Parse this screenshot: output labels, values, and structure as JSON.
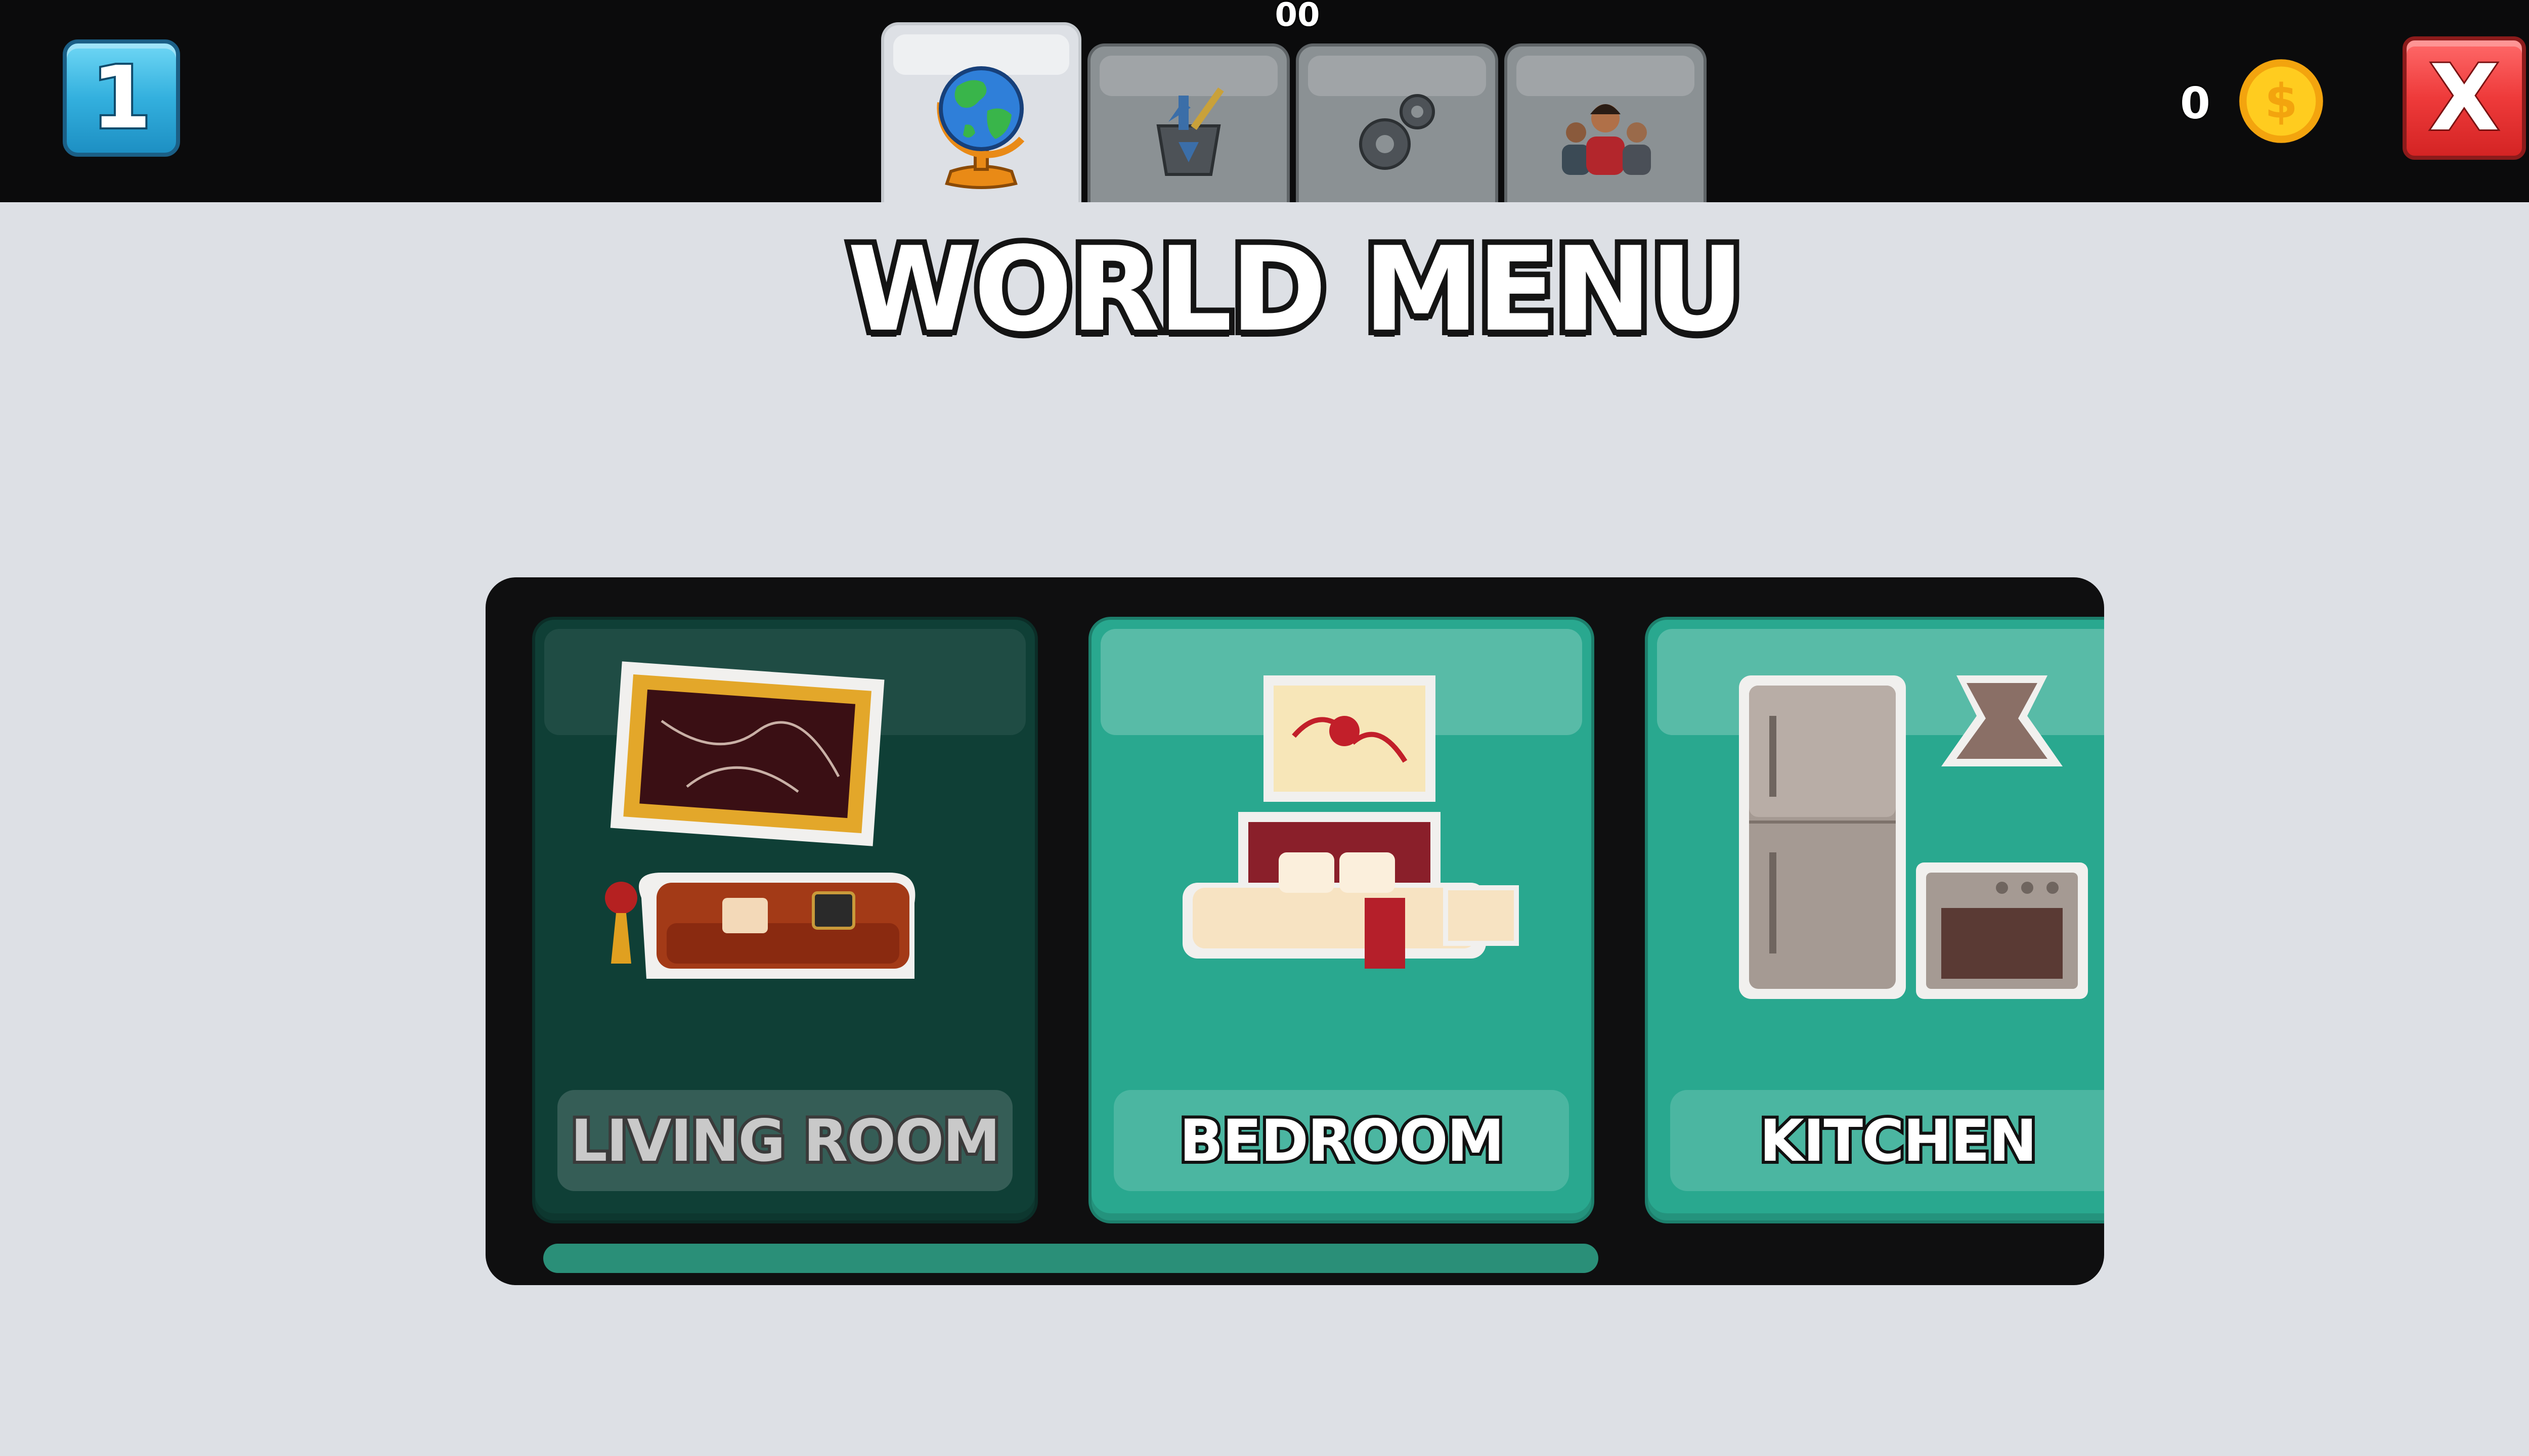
{
  "hud": {
    "level": "1",
    "top_counter": "00",
    "coins": "0",
    "close_label": "X"
  },
  "tabs": [
    {
      "name": "world",
      "icon": "globe-icon",
      "active": true
    },
    {
      "name": "tools",
      "icon": "tools-bucket-icon",
      "active": false
    },
    {
      "name": "settings",
      "icon": "gears-icon",
      "active": false
    },
    {
      "name": "characters",
      "icon": "people-icon",
      "active": false
    }
  ],
  "title": "WORLD MENU",
  "rooms": [
    {
      "label": "LIVING ROOM",
      "icon": "living-room-icon",
      "selected": true
    },
    {
      "label": "BEDROOM",
      "icon": "bedroom-icon",
      "selected": false
    },
    {
      "label": "KITCHEN",
      "icon": "kitchen-icon",
      "selected": false
    }
  ],
  "scroll": {
    "visible_fraction": 0.7
  },
  "colors": {
    "topbar": "#0b0b0c",
    "background": "#dde0e5",
    "card": "#29a88f",
    "card_selected": "#0f3f36",
    "scrollbar": "#2a8f78",
    "close": "#ee3a3a",
    "level_badge": "#33b0de"
  }
}
